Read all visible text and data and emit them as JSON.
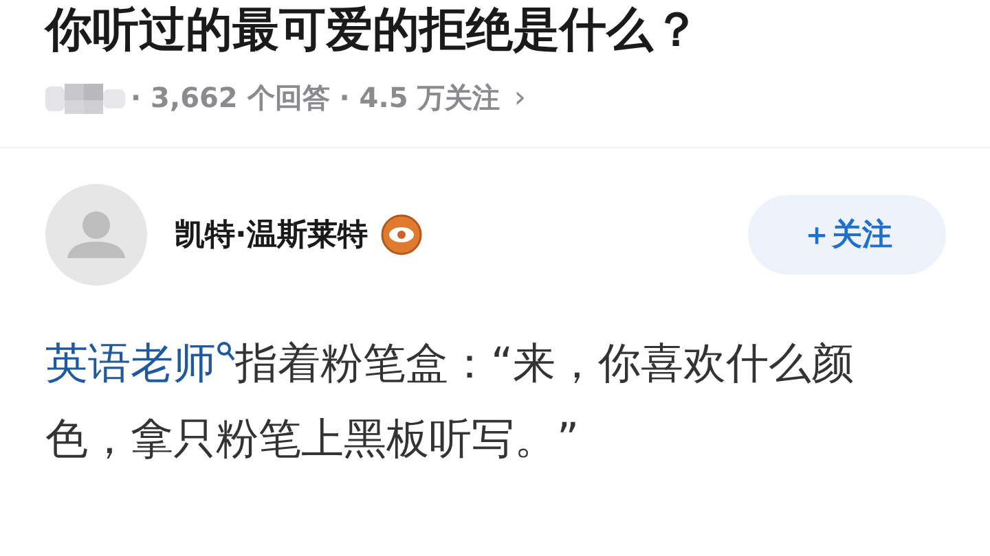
{
  "question": {
    "title": "你听过的最可爱的拒绝是什么？",
    "stats": "· 3,662 个回答 · 4.5 万关注",
    "chevron": "›"
  },
  "author": {
    "name": "凯特·温斯莱特",
    "follow_label": "＋关注"
  },
  "answer": {
    "link_text": "英语老师",
    "text": "指着粉笔盒：“来，你喜欢什么颜色，拿只粉笔上黑板听写。”"
  }
}
